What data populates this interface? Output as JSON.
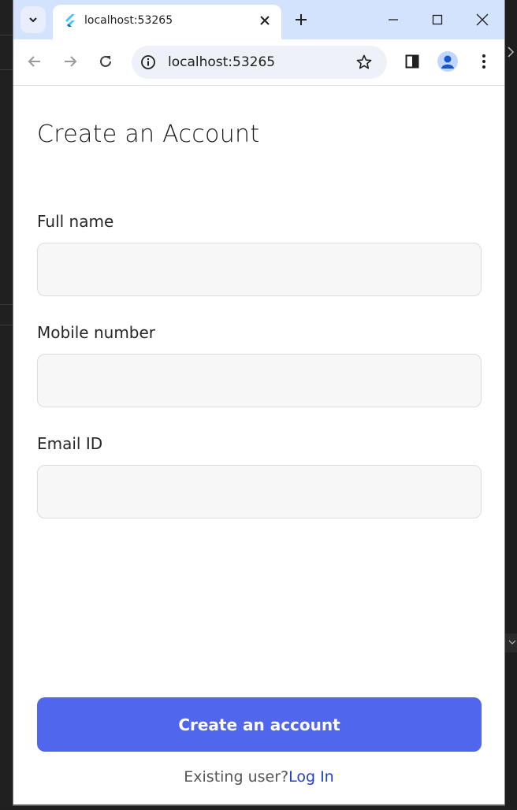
{
  "browser": {
    "tab": {
      "title": "localhost:53265"
    },
    "address_bar": {
      "url": "localhost:53265"
    }
  },
  "form": {
    "title": "Create an Account",
    "fields": [
      {
        "label": "Full name",
        "value": ""
      },
      {
        "label": "Mobile number",
        "value": ""
      },
      {
        "label": "Email ID",
        "value": ""
      }
    ],
    "submit_label": "Create an account",
    "footer": {
      "prompt": "Existing user?",
      "link": "Log In"
    }
  },
  "colors": {
    "accent": "#5066ec",
    "link": "#1f3fd0",
    "titlebar": "#d3e3fd"
  },
  "icons": [
    "tab-search-icon",
    "flutter-favicon-icon",
    "close-icon",
    "new-tab-icon",
    "minimize-icon",
    "maximize-icon",
    "close-window-icon",
    "back-icon",
    "forward-icon",
    "reload-icon",
    "site-info-icon",
    "bookmark-star-icon",
    "side-panel-icon",
    "profile-avatar-icon",
    "menu-kebab-icon"
  ]
}
